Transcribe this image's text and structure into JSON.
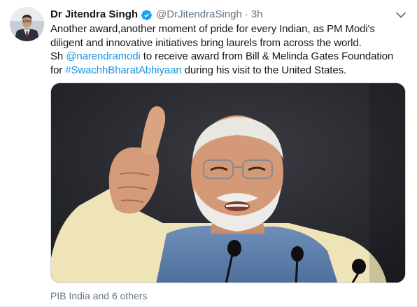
{
  "tweet": {
    "author": {
      "display_name": "Dr Jitendra Singh",
      "handle": "@DrJitendraSingh",
      "verified": true,
      "avatar_icon": "profile-photo"
    },
    "separator": "·",
    "timestamp": "3h",
    "menu_icon": "chevron-down-icon",
    "text": {
      "line1": "Another award,another moment of pride for every Indian, as PM Modi's",
      "line2": "diligent and innovative initiatives bring laurels from across the world.",
      "line3_prefix": "Sh ",
      "line3_mention": "@narendramodi",
      "line3_suffix": " to receive award from  Bill & Melinda Gates Foundation",
      "line4_prefix": "for ",
      "line4_hashtag": "#SwachhBharatAbhiyaan",
      "line4_suffix": " during his visit to the United States."
    },
    "media": {
      "type": "photo",
      "icon": "photo-thumbs-up"
    },
    "tagged_people": "PIB India and 6 others"
  },
  "colors": {
    "link": "#1b95e0",
    "secondary_text": "#657786",
    "verified": "#1da1f2",
    "primary_text": "#14171a"
  }
}
